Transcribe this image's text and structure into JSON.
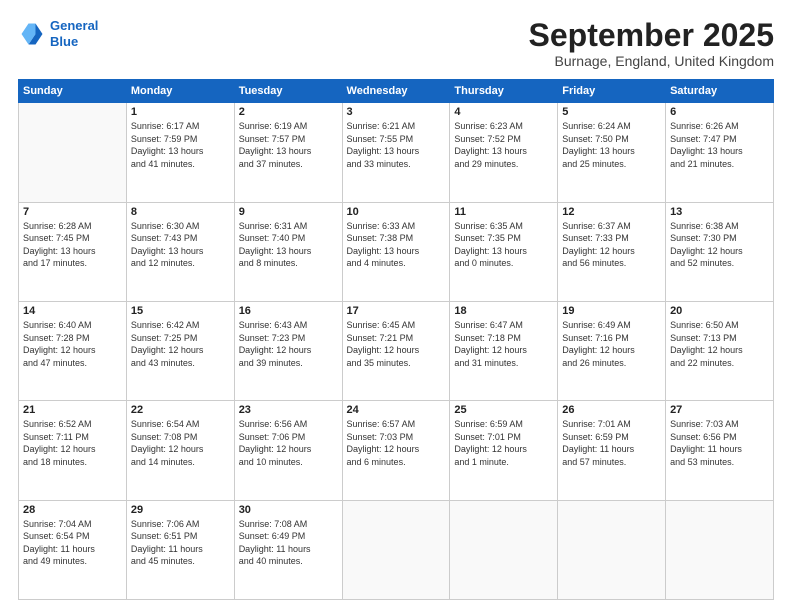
{
  "header": {
    "logo_line1": "General",
    "logo_line2": "Blue",
    "month_title": "September 2025",
    "location": "Burnage, England, United Kingdom"
  },
  "weekdays": [
    "Sunday",
    "Monday",
    "Tuesday",
    "Wednesday",
    "Thursday",
    "Friday",
    "Saturday"
  ],
  "weeks": [
    [
      {
        "day": "",
        "info": ""
      },
      {
        "day": "1",
        "info": "Sunrise: 6:17 AM\nSunset: 7:59 PM\nDaylight: 13 hours\nand 41 minutes."
      },
      {
        "day": "2",
        "info": "Sunrise: 6:19 AM\nSunset: 7:57 PM\nDaylight: 13 hours\nand 37 minutes."
      },
      {
        "day": "3",
        "info": "Sunrise: 6:21 AM\nSunset: 7:55 PM\nDaylight: 13 hours\nand 33 minutes."
      },
      {
        "day": "4",
        "info": "Sunrise: 6:23 AM\nSunset: 7:52 PM\nDaylight: 13 hours\nand 29 minutes."
      },
      {
        "day": "5",
        "info": "Sunrise: 6:24 AM\nSunset: 7:50 PM\nDaylight: 13 hours\nand 25 minutes."
      },
      {
        "day": "6",
        "info": "Sunrise: 6:26 AM\nSunset: 7:47 PM\nDaylight: 13 hours\nand 21 minutes."
      }
    ],
    [
      {
        "day": "7",
        "info": "Sunrise: 6:28 AM\nSunset: 7:45 PM\nDaylight: 13 hours\nand 17 minutes."
      },
      {
        "day": "8",
        "info": "Sunrise: 6:30 AM\nSunset: 7:43 PM\nDaylight: 13 hours\nand 12 minutes."
      },
      {
        "day": "9",
        "info": "Sunrise: 6:31 AM\nSunset: 7:40 PM\nDaylight: 13 hours\nand 8 minutes."
      },
      {
        "day": "10",
        "info": "Sunrise: 6:33 AM\nSunset: 7:38 PM\nDaylight: 13 hours\nand 4 minutes."
      },
      {
        "day": "11",
        "info": "Sunrise: 6:35 AM\nSunset: 7:35 PM\nDaylight: 13 hours\nand 0 minutes."
      },
      {
        "day": "12",
        "info": "Sunrise: 6:37 AM\nSunset: 7:33 PM\nDaylight: 12 hours\nand 56 minutes."
      },
      {
        "day": "13",
        "info": "Sunrise: 6:38 AM\nSunset: 7:30 PM\nDaylight: 12 hours\nand 52 minutes."
      }
    ],
    [
      {
        "day": "14",
        "info": "Sunrise: 6:40 AM\nSunset: 7:28 PM\nDaylight: 12 hours\nand 47 minutes."
      },
      {
        "day": "15",
        "info": "Sunrise: 6:42 AM\nSunset: 7:25 PM\nDaylight: 12 hours\nand 43 minutes."
      },
      {
        "day": "16",
        "info": "Sunrise: 6:43 AM\nSunset: 7:23 PM\nDaylight: 12 hours\nand 39 minutes."
      },
      {
        "day": "17",
        "info": "Sunrise: 6:45 AM\nSunset: 7:21 PM\nDaylight: 12 hours\nand 35 minutes."
      },
      {
        "day": "18",
        "info": "Sunrise: 6:47 AM\nSunset: 7:18 PM\nDaylight: 12 hours\nand 31 minutes."
      },
      {
        "day": "19",
        "info": "Sunrise: 6:49 AM\nSunset: 7:16 PM\nDaylight: 12 hours\nand 26 minutes."
      },
      {
        "day": "20",
        "info": "Sunrise: 6:50 AM\nSunset: 7:13 PM\nDaylight: 12 hours\nand 22 minutes."
      }
    ],
    [
      {
        "day": "21",
        "info": "Sunrise: 6:52 AM\nSunset: 7:11 PM\nDaylight: 12 hours\nand 18 minutes."
      },
      {
        "day": "22",
        "info": "Sunrise: 6:54 AM\nSunset: 7:08 PM\nDaylight: 12 hours\nand 14 minutes."
      },
      {
        "day": "23",
        "info": "Sunrise: 6:56 AM\nSunset: 7:06 PM\nDaylight: 12 hours\nand 10 minutes."
      },
      {
        "day": "24",
        "info": "Sunrise: 6:57 AM\nSunset: 7:03 PM\nDaylight: 12 hours\nand 6 minutes."
      },
      {
        "day": "25",
        "info": "Sunrise: 6:59 AM\nSunset: 7:01 PM\nDaylight: 12 hours\nand 1 minute."
      },
      {
        "day": "26",
        "info": "Sunrise: 7:01 AM\nSunset: 6:59 PM\nDaylight: 11 hours\nand 57 minutes."
      },
      {
        "day": "27",
        "info": "Sunrise: 7:03 AM\nSunset: 6:56 PM\nDaylight: 11 hours\nand 53 minutes."
      }
    ],
    [
      {
        "day": "28",
        "info": "Sunrise: 7:04 AM\nSunset: 6:54 PM\nDaylight: 11 hours\nand 49 minutes."
      },
      {
        "day": "29",
        "info": "Sunrise: 7:06 AM\nSunset: 6:51 PM\nDaylight: 11 hours\nand 45 minutes."
      },
      {
        "day": "30",
        "info": "Sunrise: 7:08 AM\nSunset: 6:49 PM\nDaylight: 11 hours\nand 40 minutes."
      },
      {
        "day": "",
        "info": ""
      },
      {
        "day": "",
        "info": ""
      },
      {
        "day": "",
        "info": ""
      },
      {
        "day": "",
        "info": ""
      }
    ]
  ]
}
